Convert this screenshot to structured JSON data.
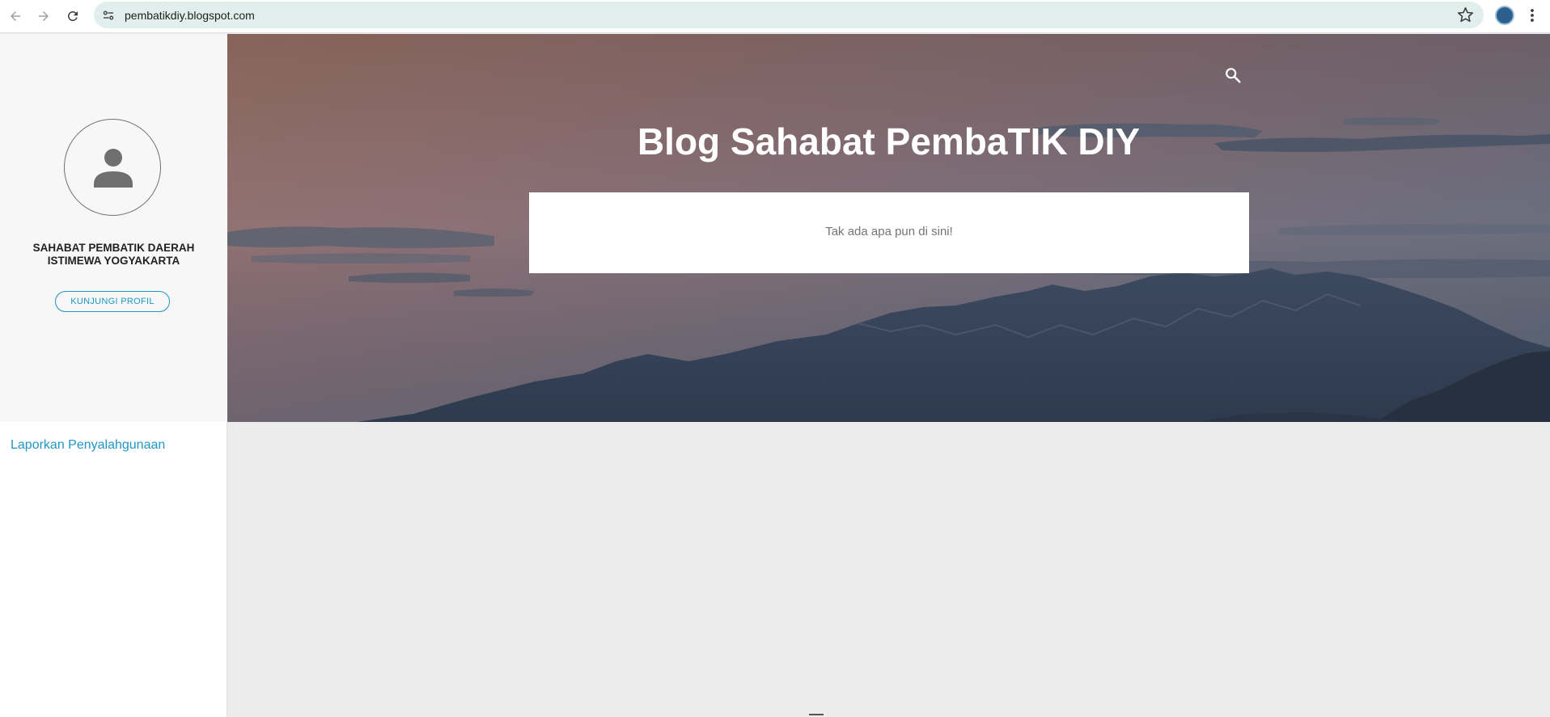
{
  "browser": {
    "url": "pembatikdiy.blogspot.com"
  },
  "sidebar": {
    "profile_name": "SAHABAT PEMBATIK DAERAH ISTIMEWA YOGYAKARTA",
    "visit_profile_label": "KUNJUNGI PROFIL",
    "report_abuse_label": "Laporkan Penyalahgunaan"
  },
  "header": {
    "title": "Blog Sahabat PembaTIK DIY",
    "empty_message": "Tak ada apa pun di sini!"
  },
  "colors": {
    "accent": "#2196c4",
    "sidebar_bg": "#f7f7f7",
    "content_bg": "#ececec",
    "omnibox_bg": "#e1efec"
  }
}
